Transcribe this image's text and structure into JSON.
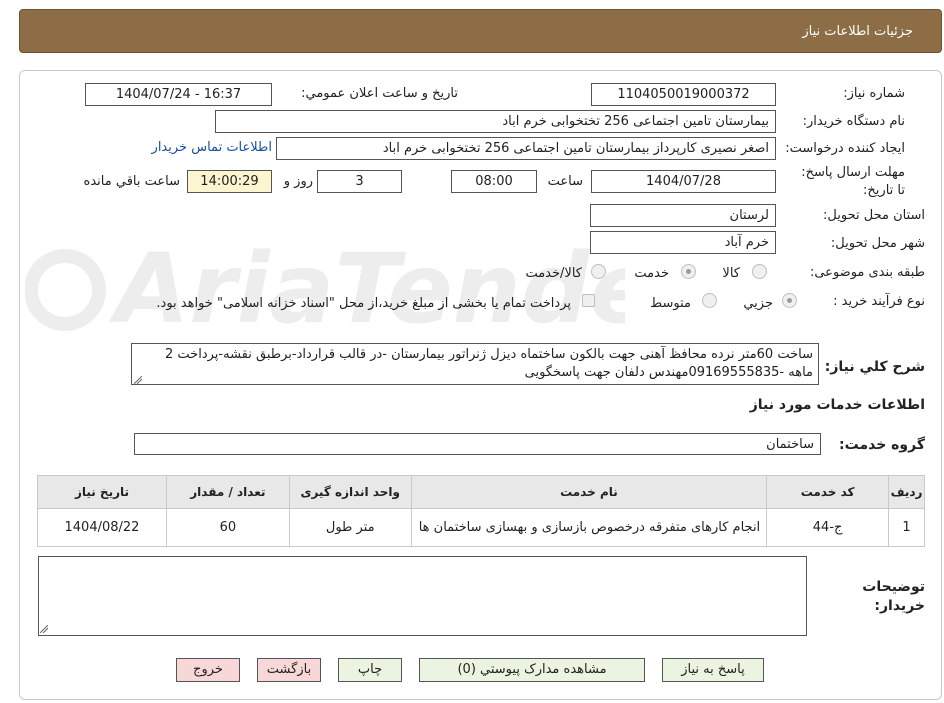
{
  "header": {
    "title": "جزئیات اطلاعات نیاز"
  },
  "fields": {
    "need_number_label": "شماره نیاز:",
    "need_number": "1104050019000372",
    "announce_label": "تاریخ و ساعت اعلان عمومي:",
    "announce_value": "1404/07/24 - 16:37",
    "buyer_org_label": "نام دستگاه خریدار:",
    "buyer_org": "بیمارستان تامین اجتماعی  256 تختخوابی خرم اباد",
    "requester_label": "ایجاد کننده درخواست:",
    "requester": "اصغر نصیری کارپرداز بیمارستان تامین اجتماعی  256 تختخوابی خرم اباد",
    "contact_link": "اطلاعات تماس خریدار",
    "deadline_label": "مهلت ارسال پاسخ: تا تاریخ:",
    "deadline_date": "1404/07/28",
    "time_label": "ساعت",
    "deadline_time": "08:00",
    "days": "3",
    "days_label": "روز و",
    "remaining_time": "14:00:29",
    "remaining_label": "ساعت باقي مانده",
    "province_label": "استان محل تحویل:",
    "province": "لرستان",
    "city_label": "شهر محل تحویل:",
    "city": "خرم آباد",
    "category_label": "طبقه بندی موضوعی:",
    "category_options": [
      "کالا",
      "خدمت",
      "کالا/خدمت"
    ],
    "process_label": "نوع فرآیند خرید :",
    "process_options": [
      "جزیي",
      "متوسط"
    ],
    "payment_note": "پرداخت تمام یا بخشی از مبلغ خرید،از محل \"اسناد خزانه اسلامی\" خواهد بود.",
    "description_label": "شرح کلي نیاز:",
    "description": "ساخت 60متر نرده محافظ آهنی جهت بالکون ساختماه دیزل ژنراتور بیمارستان -در قالب قرارداد-برطبق نقشه-پرداخت  2 ماهه -09169555835مهندس دلفان جهت پاسخگویی"
  },
  "services": {
    "section_title": "اطلاعات خدمات مورد نیاز",
    "group_label": "گروه خدمت:",
    "group_value": "ساختمان",
    "columns": [
      "ردیف",
      "کد خدمت",
      "نام خدمت",
      "واحد اندازه گیری",
      "تعداد / مقدار",
      "تاریخ نیاز"
    ],
    "rows": [
      [
        "1",
        "ج-44",
        "انجام کارهای متفرقه درخصوص بازسازی و بهسازی ساختمان ها",
        "متر طول",
        "60",
        "1404/08/22"
      ]
    ]
  },
  "notes": {
    "label": "توضیحات خریدار:",
    "value": ""
  },
  "buttons": {
    "reply": "پاسخ به نیاز",
    "attachments": "مشاهده مدارک پیوستي (0)",
    "print": "چاپ",
    "back": "بازگشت",
    "exit": "خروج"
  },
  "colors": {
    "header_bg": "#8c6d45",
    "button_green": "#eaf4e0",
    "button_pink": "#f7d7d7",
    "timer_bg": "#fcf5cf",
    "link": "#1a4fa0"
  },
  "watermark": "AriaTender.neT"
}
